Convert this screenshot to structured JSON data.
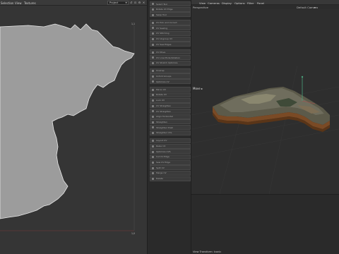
{
  "uv_editor": {
    "menu": [
      "Selection",
      "View",
      "Textures"
    ],
    "project_select": {
      "value": "Project"
    },
    "coords": {
      "top_right": "1,1",
      "bottom_right": "1,0"
    }
  },
  "tools": [
    {
      "label": "Select Tool"
    },
    {
      "label": "Rotate UV Edge"
    },
    {
      "label": "Swap Tool"
    },
    {
      "label": "UV Pick and Correct",
      "sep": true
    },
    {
      "label": "UV Sewing"
    },
    {
      "label": "UV Stitching"
    },
    {
      "label": "UV Ungroup UV"
    },
    {
      "label": "UV Sew Edges"
    },
    {
      "label": "UV Move",
      "sep": true
    },
    {
      "label": "UV Line Mode Rotation"
    },
    {
      "label": "UV Stretch Optimize"
    },
    {
      "label": "Unwrap",
      "sep": true
    },
    {
      "label": "Unfold Groups"
    },
    {
      "label": "Optimize UV"
    },
    {
      "label": "Mirror UV",
      "sep": true
    },
    {
      "label": "Rotate UV"
    },
    {
      "label": "Lock UV"
    },
    {
      "label": "UV Straighten"
    },
    {
      "label": "UV Straighten"
    },
    {
      "label": "Align Horizontal"
    },
    {
      "label": "Straighten"
    },
    {
      "label": "Straighten Shell"
    },
    {
      "label": "Straighten UVs"
    },
    {
      "label": "Layout UV",
      "sep": true
    },
    {
      "label": "Relax UV"
    },
    {
      "label": "Optimize UVS"
    },
    {
      "label": "Cut UV Edge"
    },
    {
      "label": "Sew UV Edge"
    },
    {
      "label": "Split UV"
    },
    {
      "label": "Merge UV"
    },
    {
      "label": "Delete"
    }
  ],
  "viewport": {
    "menu": [
      "View",
      "Cameras",
      "Display",
      "Options",
      "Filter",
      "Panel"
    ],
    "perspective": "Perspective",
    "camera": "Default Camera",
    "move_tag": "Move",
    "status": "View Transform: Iconic",
    "colors": {
      "accent_green": "#4aa07a",
      "terrain": "#6b6a5c"
    }
  }
}
